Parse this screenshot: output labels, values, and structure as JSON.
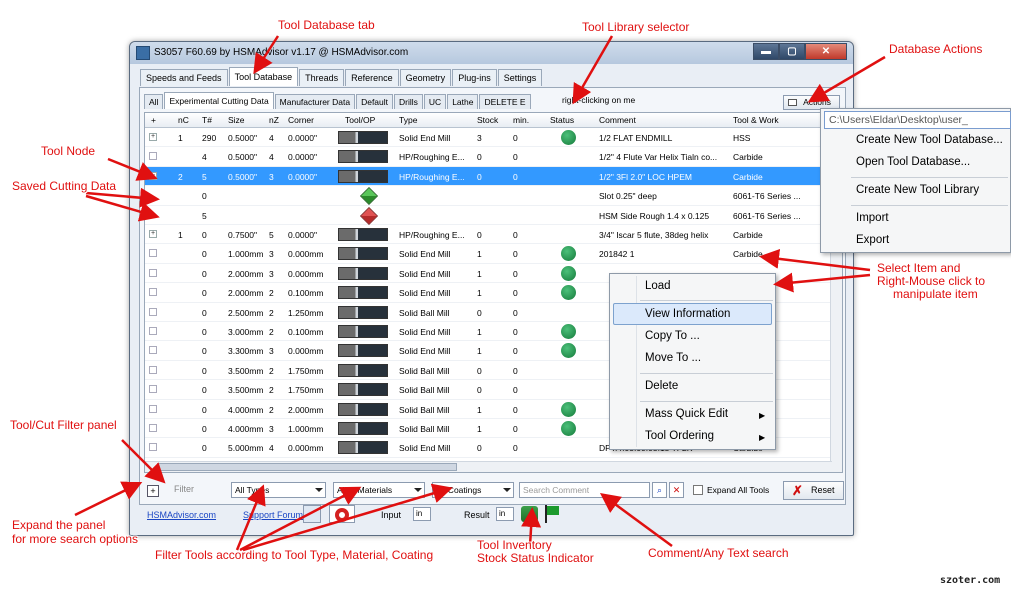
{
  "window": {
    "title": "S3057 F60.69 by HSMAdvisor v1.17 @ HSMAdvisor.com",
    "buttons": {
      "minimize": "▬",
      "maximize": "▢",
      "close": "✕"
    }
  },
  "main_tabs": [
    {
      "label": "Speeds and Feeds",
      "active": false
    },
    {
      "label": "Tool Database",
      "active": true
    },
    {
      "label": "Threads",
      "active": false
    },
    {
      "label": "Reference",
      "active": false
    },
    {
      "label": "Geometry",
      "active": false
    },
    {
      "label": "Plug-ins",
      "active": false
    },
    {
      "label": "Settings",
      "active": false
    }
  ],
  "sub_tabs": [
    {
      "label": "All",
      "active": false
    },
    {
      "label": "Experimental Cutting Data",
      "active": true
    },
    {
      "label": "Manufacturer Data",
      "active": false
    },
    {
      "label": "Default",
      "active": false
    },
    {
      "label": "Drills",
      "active": false
    },
    {
      "label": "UC",
      "active": false
    },
    {
      "label": "Lathe",
      "active": false
    },
    {
      "label": "DELETE E",
      "active": false
    }
  ],
  "actions_label": "Actions",
  "columns": [
    "+",
    "nC",
    "T#",
    "Size",
    "nZ",
    "Corner",
    "Tool/OP",
    "Type",
    "Stock",
    "min.",
    "Status",
    "Comment",
    "Tool & Work"
  ],
  "rows": [
    {
      "exp": "+",
      "nC": "1",
      "t": "290",
      "size": "0.5000\"",
      "nz": "4",
      "corner": "0.0000\"",
      "img": "tool",
      "type": "Solid End Mill",
      "stock": "3",
      "min": "0",
      "status": true,
      "comment": "1/2 FLAT ENDMILL",
      "tw": "HSS",
      "sel": false
    },
    {
      "exp": "box",
      "nC": "",
      "t": "4",
      "size": "0.5000\"",
      "nz": "4",
      "corner": "0.0000\"",
      "img": "tool",
      "type": "HP/Roughing E...",
      "stock": "0",
      "min": "0",
      "status": false,
      "comment": "1/2\" 4 Flute Var Helix Tialn co...",
      "tw": "Carbide",
      "sel": false
    },
    {
      "exp": "−",
      "nC": "2",
      "t": "5",
      "size": "0.5000\"",
      "nz": "3",
      "corner": "0.0000\"",
      "img": "tool",
      "type": "HP/Roughing E...",
      "stock": "0",
      "min": "0",
      "status": false,
      "comment": "1/2\" 3Fl 2.0\" LOC HPEM",
      "tw": "Carbide",
      "sel": true
    },
    {
      "exp": "",
      "nC": "",
      "t": "0",
      "size": "",
      "nz": "",
      "corner": "",
      "img": "cube-green",
      "type": "",
      "stock": "",
      "min": "",
      "status": false,
      "comment": "Slot 0.25\" deep",
      "tw": "6061-T6 Series ...",
      "sel": false
    },
    {
      "exp": "",
      "nC": "",
      "t": "5",
      "size": "",
      "nz": "",
      "corner": "",
      "img": "cube-red",
      "type": "",
      "stock": "",
      "min": "",
      "status": false,
      "comment": "HSM Side Rough 1.4 x 0.125",
      "tw": "6061-T6 Series ...",
      "sel": false
    },
    {
      "exp": "+",
      "nC": "1",
      "t": "0",
      "size": "0.7500\"",
      "nz": "5",
      "corner": "0.0000\"",
      "img": "tool",
      "type": "HP/Roughing E...",
      "stock": "0",
      "min": "0",
      "status": false,
      "comment": "3/4\" Iscar 5 flute, 38deg helix",
      "tw": "Carbide",
      "sel": false
    },
    {
      "exp": "box",
      "nC": "",
      "t": "0",
      "size": "1.000mm",
      "nz": "3",
      "corner": "0.000mm",
      "img": "tool",
      "type": "Solid End Mill",
      "stock": "1",
      "min": "0",
      "status": true,
      "comment": "201842 1",
      "tw": "Carbide",
      "sel": false
    },
    {
      "exp": "box",
      "nC": "",
      "t": "0",
      "size": "2.000mm",
      "nz": "3",
      "corner": "0.000mm",
      "img": "tool",
      "type": "Solid End Mill",
      "stock": "1",
      "min": "0",
      "status": true,
      "comment": "",
      "tw": "",
      "sel": false
    },
    {
      "exp": "box",
      "nC": "",
      "t": "0",
      "size": "2.000mm",
      "nz": "2",
      "corner": "0.100mm",
      "img": "tool",
      "type": "Solid End Mill",
      "stock": "1",
      "min": "0",
      "status": true,
      "comment": "",
      "tw": "",
      "sel": false
    },
    {
      "exp": "box",
      "nC": "",
      "t": "0",
      "size": "2.500mm",
      "nz": "2",
      "corner": "1.250mm",
      "img": "tool",
      "type": "Solid Ball Mill",
      "stock": "0",
      "min": "0",
      "status": false,
      "comment": "",
      "tw": "",
      "sel": false
    },
    {
      "exp": "box",
      "nC": "",
      "t": "0",
      "size": "3.000mm",
      "nz": "2",
      "corner": "0.100mm",
      "img": "tool",
      "type": "Solid End Mill",
      "stock": "1",
      "min": "0",
      "status": true,
      "comment": "",
      "tw": "",
      "sel": false
    },
    {
      "exp": "box",
      "nC": "",
      "t": "0",
      "size": "3.300mm",
      "nz": "3",
      "corner": "0.000mm",
      "img": "tool",
      "type": "Solid End Mill",
      "stock": "1",
      "min": "0",
      "status": true,
      "comment": "",
      "tw": "",
      "sel": false
    },
    {
      "exp": "box",
      "nC": "",
      "t": "0",
      "size": "3.500mm",
      "nz": "2",
      "corner": "1.750mm",
      "img": "tool",
      "type": "Solid Ball Mill",
      "stock": "0",
      "min": "0",
      "status": false,
      "comment": "",
      "tw": "",
      "sel": false
    },
    {
      "exp": "box",
      "nC": "",
      "t": "0",
      "size": "3.500mm",
      "nz": "2",
      "corner": "1.750mm",
      "img": "tool",
      "type": "Solid Ball Mill",
      "stock": "0",
      "min": "0",
      "status": false,
      "comment": "",
      "tw": "",
      "sel": false
    },
    {
      "exp": "box",
      "nC": "",
      "t": "0",
      "size": "4.000mm",
      "nz": "2",
      "corner": "2.000mm",
      "img": "tool",
      "type": "Solid Ball Mill",
      "stock": "1",
      "min": "0",
      "status": true,
      "comment": "",
      "tw": "",
      "sel": false
    },
    {
      "exp": "box",
      "nC": "",
      "t": "0",
      "size": "4.000mm",
      "nz": "3",
      "corner": "1.000mm",
      "img": "tool",
      "type": "Solid Ball Mill",
      "stock": "1",
      "min": "0",
      "status": true,
      "comment": "",
      "tw": "",
      "sel": false
    },
    {
      "exp": "box",
      "nC": "",
      "t": "0",
      "size": "5.000mm",
      "nz": "4",
      "corner": "0.000mm",
      "img": "tool",
      "type": "Solid End Mill",
      "stock": "0",
      "min": "0",
      "status": false,
      "comment": "DPT.4.05.00.05.15 TF2K",
      "tw": "Carbide",
      "sel": false
    }
  ],
  "filter": {
    "label": "Filter",
    "types": "All Types",
    "materials": "All T. Materials",
    "coatings": "All Coatings",
    "search_placeholder": "Search Comment",
    "expand_all": "Expand All Tools",
    "reset": "Reset"
  },
  "status_bar": {
    "website": "HSMAdvisor.com",
    "support": "Support Forums",
    "input_label": "Input",
    "input_value": "in",
    "result_label": "Result",
    "result_value": "in"
  },
  "db_menu": {
    "path": "C:\\Users\\Eldar\\Desktop\\user_",
    "items": [
      "Create New Tool Database...",
      "Open Tool Database...",
      "Create New Tool Library",
      "Import",
      "Export"
    ]
  },
  "context_menu": {
    "items": [
      "Load",
      "View Information",
      "Copy To ...",
      "Move To ...",
      "Delete",
      "Mass Quick Edit",
      "Tool Ordering"
    ],
    "highlighted": "View Information"
  },
  "annotations": {
    "tool_database_tab": "Tool Database tab",
    "tool_library_selector": "Tool Library selector",
    "database_actions": "Database Actions",
    "tool_node": "Tool Node",
    "saved_cutting_data": "Saved Cutting Data",
    "select_item": "Select Item and",
    "right_mouse": "Right-Mouse click to",
    "manipulate": "manipulate item",
    "filter_panel": "Tool/Cut Filter panel",
    "expand_panel_1": "Expand the panel",
    "expand_panel_2": "for more search options",
    "filter_tools": "Filter Tools according to Tool Type, Material, Coating",
    "inventory_1": "Tool Inventory",
    "inventory_2": "Stock Status Indicator",
    "comment_search": "Comment/Any Text search",
    "subtab_hint": "right-clicking on me"
  },
  "watermark": "szoter.com",
  "colors": {
    "selection": "#3399ff",
    "annotation": "#e01010",
    "status_ok": "#1f8f4a",
    "link": "#1a46c4"
  }
}
